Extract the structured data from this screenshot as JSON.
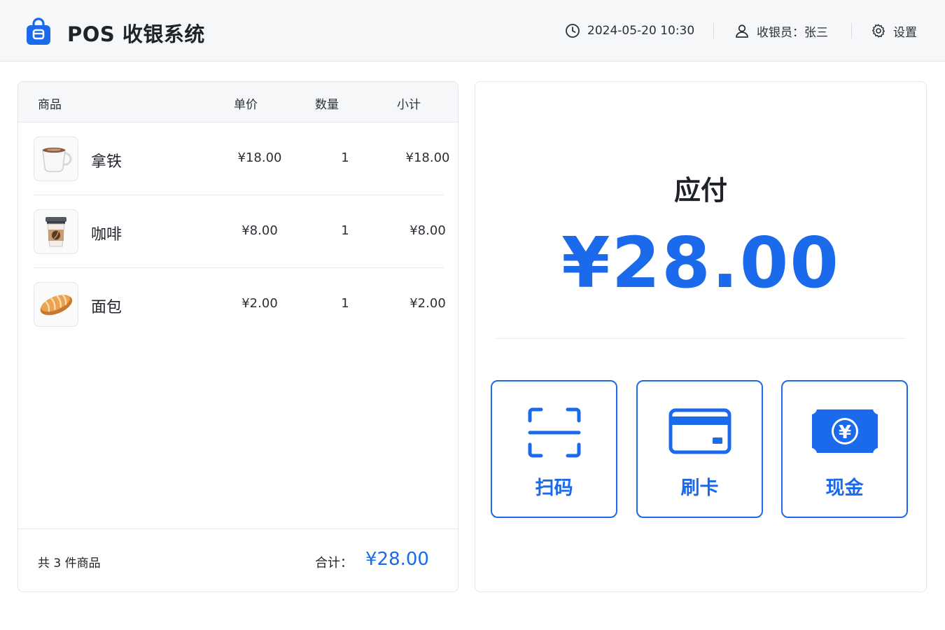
{
  "header": {
    "app_title": "POS 收银系统",
    "datetime": "2024-05-20 10:30",
    "cashier": "收银员：张三",
    "settings_label": "设置"
  },
  "cart": {
    "columns": {
      "product": "商品",
      "unit_price": "单价",
      "quantity": "数量",
      "subtotal": "小计"
    },
    "items": [
      {
        "name": "拿铁",
        "unit_price": "¥18.00",
        "quantity": "1",
        "subtotal": "¥18.00",
        "icon": "coffee-cup-icon"
      },
      {
        "name": "咖啡",
        "unit_price": "¥8.00",
        "quantity": "1",
        "subtotal": "¥8.00",
        "icon": "takeaway-coffee-icon"
      },
      {
        "name": "面包",
        "unit_price": "¥2.00",
        "quantity": "1",
        "subtotal": "¥2.00",
        "icon": "bread-icon"
      }
    ],
    "count_text": "共 3 件商品",
    "total_label": "合计：",
    "total_value": "¥28.00"
  },
  "payment": {
    "due_label": "应付",
    "due_amount": "¥28.00",
    "methods": [
      {
        "label": "扫码",
        "icon": "scan-icon"
      },
      {
        "label": "刷卡",
        "icon": "bank-card-icon"
      },
      {
        "label": "现金",
        "icon": "cash-icon"
      }
    ]
  },
  "colors": {
    "accent": "#1a6aeb",
    "header_bg": "#f6f7f9",
    "border": "#e4e6ea"
  }
}
